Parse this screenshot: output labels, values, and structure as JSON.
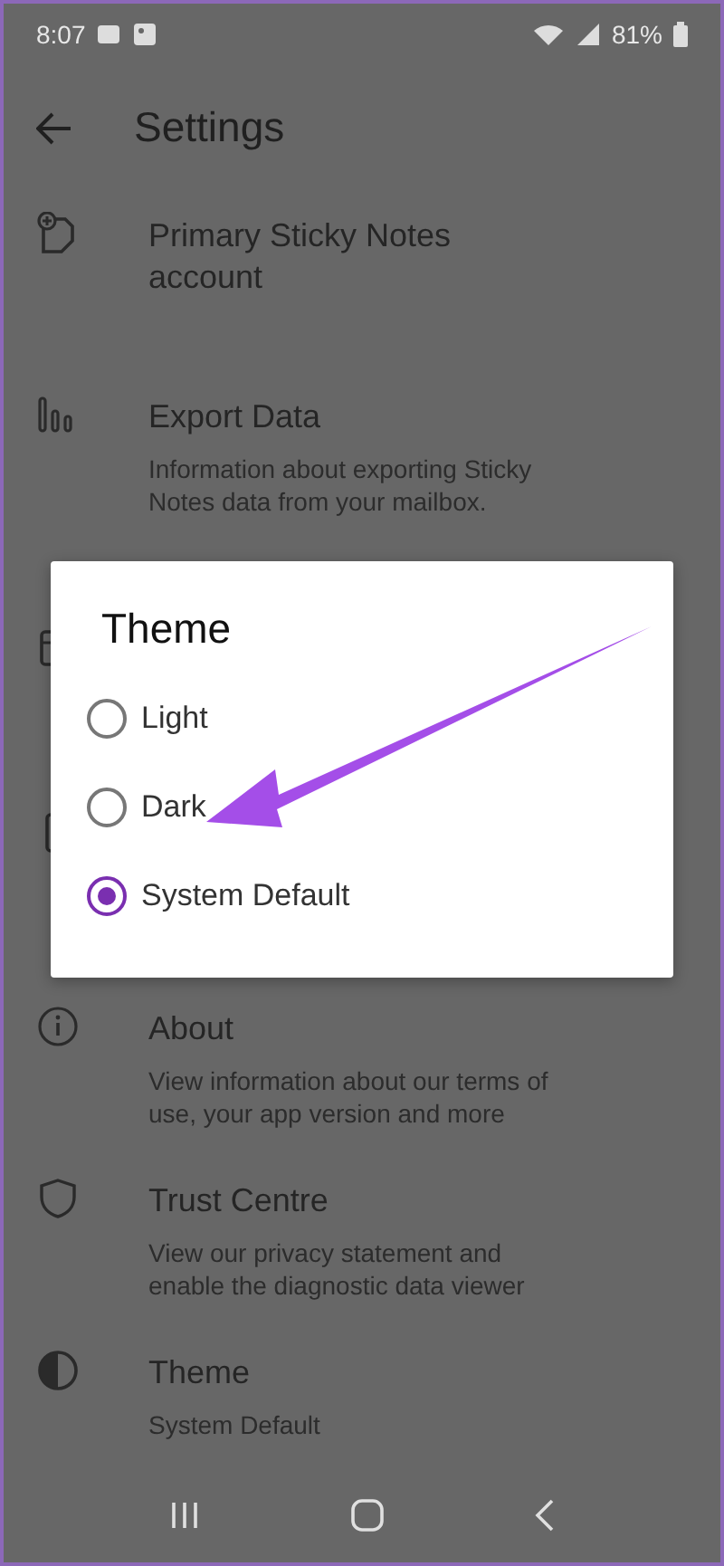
{
  "status_bar": {
    "time": "8:07",
    "battery": "81%"
  },
  "app_bar": {
    "title": "Settings"
  },
  "settings": [
    {
      "kind": "item",
      "title": "Primary Sticky Notes account"
    },
    {
      "kind": "item",
      "title": "Export Data",
      "subtitle": "Information about exporting Sticky Notes data from your mailbox."
    },
    {
      "kind": "covered"
    },
    {
      "kind": "covered"
    },
    {
      "kind": "item",
      "title": "About",
      "subtitle": "View information about our terms of use, your app version and more"
    },
    {
      "kind": "item",
      "title": "Trust Centre",
      "subtitle": "View our privacy statement and enable the diagnostic data viewer"
    },
    {
      "kind": "item",
      "title": "Theme",
      "subtitle": "System Default"
    }
  ],
  "dialog": {
    "title": "Theme",
    "options": [
      {
        "label": "Light",
        "selected": false
      },
      {
        "label": "Dark",
        "selected": false
      },
      {
        "label": "System Default",
        "selected": true
      }
    ]
  }
}
